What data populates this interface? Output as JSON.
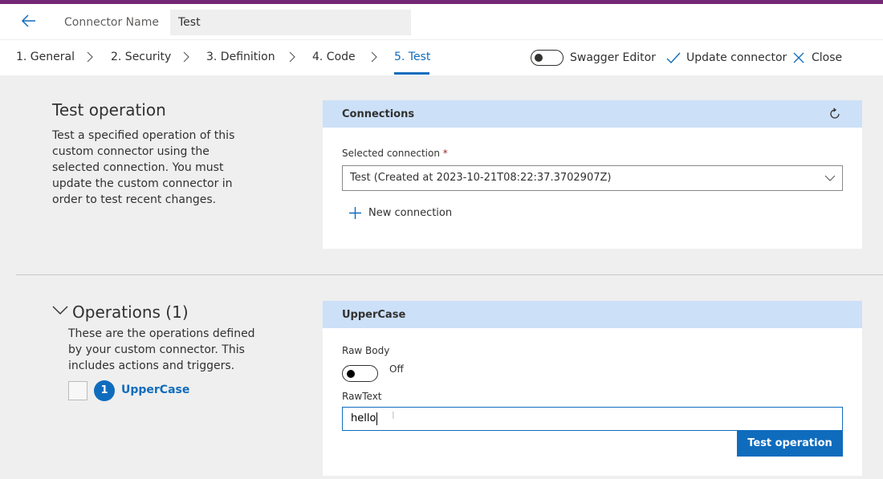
{
  "header": {
    "connector_name_label": "Connector Name",
    "connector_name_value": "Test"
  },
  "nav": {
    "steps": [
      "1. General",
      "2. Security",
      "3. Definition",
      "4. Code",
      "5. Test"
    ],
    "active_step": "5. Test",
    "swagger_editor_label": "Swagger Editor",
    "swagger_editor_on": false,
    "update_connector_label": "Update connector",
    "close_label": "Close"
  },
  "test_operation": {
    "title": "Test operation",
    "description": "Test a specified operation of this custom connector using the selected connection. You must update the custom connector in order to test recent changes."
  },
  "connections": {
    "title": "Connections",
    "selected_label": "Selected connection",
    "required_mark": "*",
    "selected_value": "Test (Created at 2023-10-21T08:22:37.3702907Z)",
    "new_connection_label": "New connection"
  },
  "operations": {
    "title": "Operations (1)",
    "description": "These are the operations defined by your custom connector. This includes actions and triggers.",
    "items": [
      {
        "number": "1",
        "name": "UpperCase"
      }
    ]
  },
  "uppercase_panel": {
    "title": "UpperCase",
    "raw_body_label": "Raw Body",
    "raw_body_state": "Off",
    "rawtext_label": "RawText",
    "rawtext_value": "hello",
    "test_button_label": "Test operation"
  },
  "colors": {
    "accent": "#0f6cbd",
    "top_strip": "#742774",
    "panel_header": "#cce0f8",
    "background": "#efefef"
  }
}
